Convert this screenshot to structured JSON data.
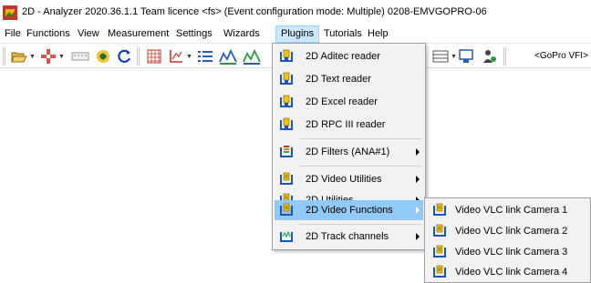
{
  "window": {
    "title": "2D - Analyzer 2020.36.1.1   Team licence   <fs>   (Event configuration mode: Multiple)   0208-EMVGOPRO-06"
  },
  "menubar": {
    "items": [
      "File",
      "Functions",
      "View",
      "Measurement",
      "Settings",
      "Wizards",
      "Plugins",
      "Tutorials",
      "Help"
    ],
    "active": "Plugins"
  },
  "toolbar": {
    "gopro_label": "<GoPro VFI>"
  },
  "plugins_menu": {
    "items": [
      {
        "label": "2D Aditec reader",
        "submenu": false
      },
      {
        "label": "2D Text reader",
        "submenu": false
      },
      {
        "label": "2D Excel reader",
        "submenu": false
      },
      {
        "label": "2D RPC III reader",
        "submenu": false
      },
      {
        "label": "2D Filters (ANA#1)",
        "submenu": true
      },
      {
        "label": "2D Video Utilities",
        "submenu": true
      },
      {
        "label": "2D Utilities",
        "submenu": true
      },
      {
        "label": "2D Video Functions",
        "submenu": true,
        "highlighted": true
      },
      {
        "label": "2D Track channels",
        "submenu": true
      }
    ]
  },
  "video_functions_submenu": {
    "items": [
      {
        "label": "Video VLC link Camera 1"
      },
      {
        "label": "Video VLC link Camera 2"
      },
      {
        "label": "Video VLC link Camera 3"
      },
      {
        "label": "Video VLC link Camera 4"
      }
    ]
  },
  "colors": {
    "menu_highlight": "#91c9f7",
    "menubar_active": "#cce8ff",
    "menu_background": "#f2f2f2"
  }
}
